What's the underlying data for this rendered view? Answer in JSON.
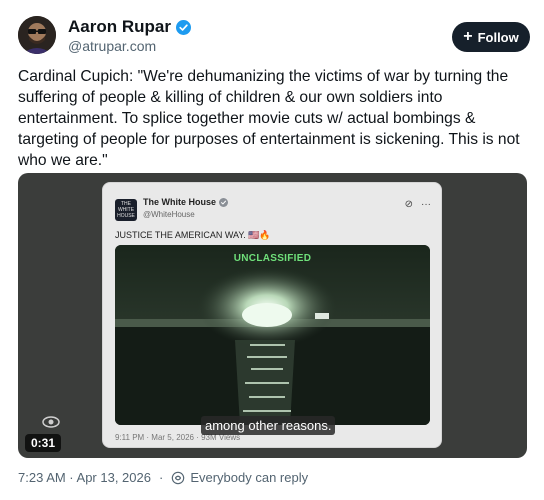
{
  "author": {
    "name": "Aaron Rupar",
    "handle": "@atrupar.com",
    "follow_label": "Follow",
    "avatar_icon": "person-avatar"
  },
  "post": {
    "text": "Cardinal Cupich: \"We're dehumanizing the victims of war by turning the suffering of people & killing of children & our own soldiers into entertainment. To splice together movie cuts w/ actual bombings & targeting of people for purposes of entertainment is sickening. This is not who we are.\""
  },
  "video": {
    "duration": "0:31",
    "caption": "among other reasons.",
    "embedded_post": {
      "avatar_text": "THE WHITE HOUSE",
      "name": "The White House",
      "handle": "@WhiteHouse",
      "text": "JUSTICE THE AMERICAN WAY. 🇺🇸🔥",
      "media_label": "UNCLASSIFIED",
      "timestamp": "9:11 PM · Mar 5, 2026 · 93M Views"
    }
  },
  "footer": {
    "timestamp": "7:23 AM · Apr 13, 2026",
    "reply_setting": "Everybody can reply"
  },
  "colors": {
    "follow_bg": "#16202b",
    "verified": "#1d9bf0",
    "muted_text": "#536471",
    "green_label": "#6fe07a"
  }
}
